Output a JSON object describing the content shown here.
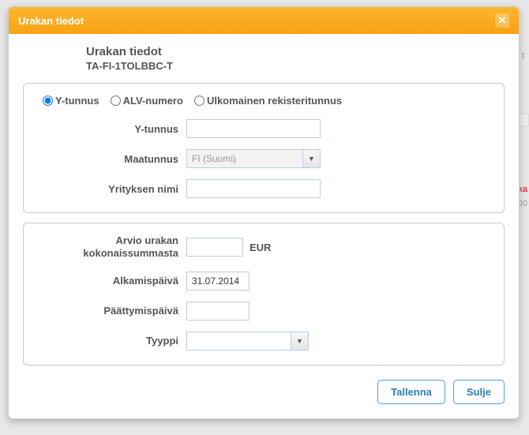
{
  "dialog": {
    "title": "Urakan tiedot"
  },
  "heading": {
    "title": "Urakan tiedot",
    "subtitle": "TA-FI-1TOLBBC-T"
  },
  "radios": {
    "ytunnus": "Y-tunnus",
    "alv": "ALV-numero",
    "foreign": "Ulkomainen rekisteritunnus"
  },
  "section1": {
    "ytunnus": {
      "label": "Y-tunnus",
      "value": ""
    },
    "maatunnus": {
      "label": "Maatunnus",
      "value": "FI (Suomi)"
    },
    "yritys": {
      "label": "Yrityksen nimi",
      "value": ""
    }
  },
  "section2": {
    "arvio": {
      "label1": "Arvio urakan",
      "label2": "kokonaissummasta",
      "value": "",
      "suffix": "EUR"
    },
    "alku": {
      "label": "Alkamispäivä",
      "value": "31.07.2014"
    },
    "loppu": {
      "label": "Päättymispäivä",
      "value": ""
    },
    "tyyppi": {
      "label": "Tyyppi",
      "value": ""
    }
  },
  "buttons": {
    "save": "Tallenna",
    "close": "Sulje"
  },
  "bgfrag": {
    "f1": "t",
    "f3": "ka",
    "f4": "00"
  }
}
